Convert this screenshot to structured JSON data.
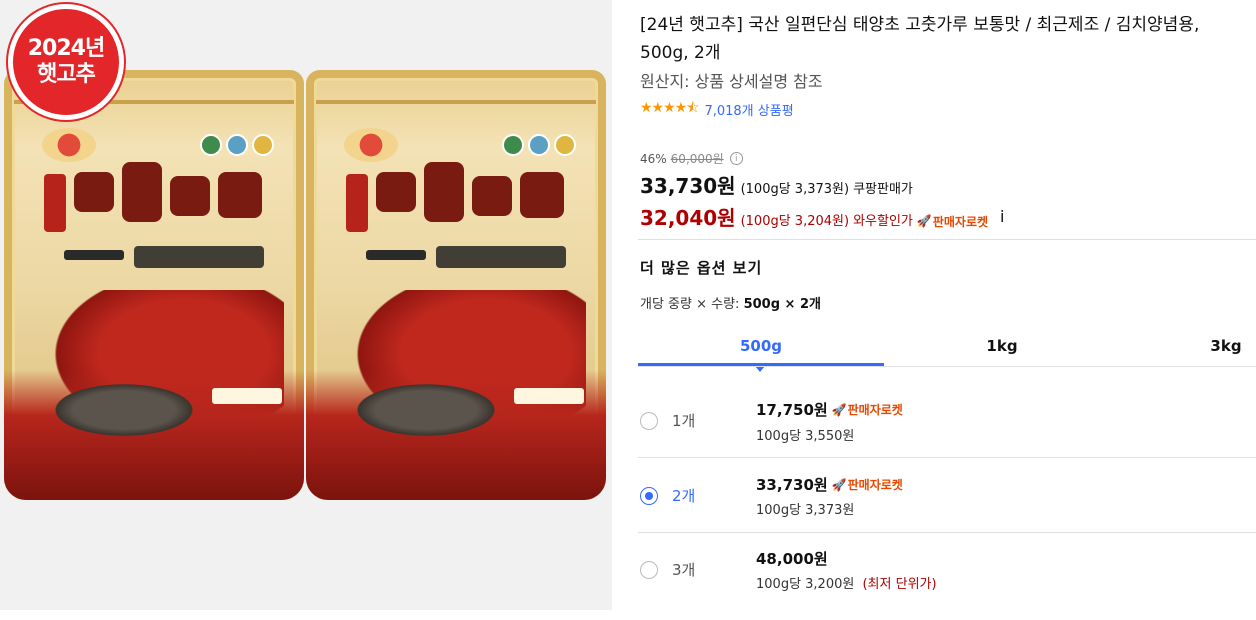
{
  "badge": {
    "line1": "2024년",
    "line2": "햇고추"
  },
  "product": {
    "title": "[24년 햇고추] 국산 일편단심 태양초 고춧가루 보통맛 / 최근제조 / 김치양념용, 500g, 2개",
    "origin": "원산지: 상품 상세설명 참조",
    "rating_stars": "★★★★⯪",
    "rating_value": 4.5,
    "review_count": "7,018개 상품평"
  },
  "pricing": {
    "discount_rate": "46%",
    "original_price": "60,000원",
    "info_icon": "i",
    "sale_price": "33,730원",
    "sale_unit_price": "(100g당 3,373원)",
    "sale_label": "쿠팡판매가",
    "wow_price": "32,040원",
    "wow_unit_price": "(100g당 3,204원)",
    "wow_label": "와우할인가",
    "rocket_icon": "🚀",
    "rocket_label": "판매자로켓"
  },
  "options": {
    "more_title": "더 많은 옵션 보기",
    "summary_prefix": "개당 중량 × 수량:",
    "summary_value": "500g × 2개",
    "tabs": [
      {
        "label": "500g",
        "active": true
      },
      {
        "label": "1kg",
        "active": false
      },
      {
        "label": "3kg",
        "active": false
      }
    ],
    "items": [
      {
        "qty": "1개",
        "price": "17,750원",
        "rocket": "판매자로켓",
        "unit": "100g당 3,550원",
        "note": "",
        "selected": false
      },
      {
        "qty": "2개",
        "price": "33,730원",
        "rocket": "판매자로켓",
        "unit": "100g당 3,373원",
        "note": "",
        "selected": true
      },
      {
        "qty": "3개",
        "price": "48,000원",
        "rocket": "",
        "unit": "100g당 3,200원",
        "note": "(최저 단위가)",
        "selected": false
      }
    ]
  },
  "colors": {
    "accent_blue": "#346aff",
    "price_red": "#ae0000",
    "rocket_orange": "#e64800",
    "star_orange": "#ff9600",
    "badge_red": "#e3262a"
  }
}
